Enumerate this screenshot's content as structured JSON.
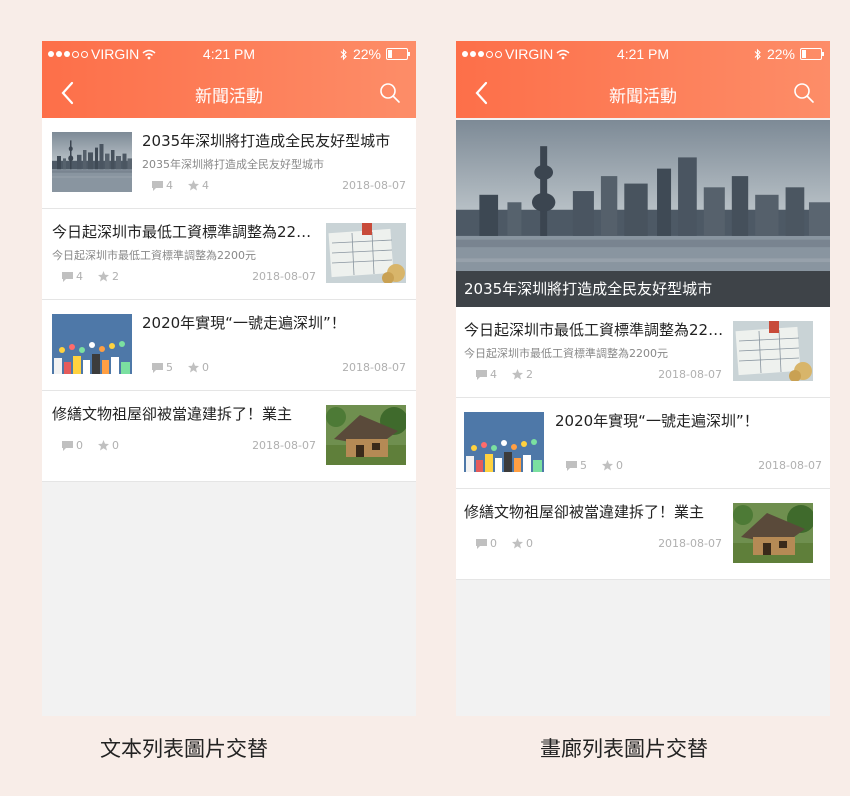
{
  "status_bar": {
    "carrier": "VIRGIN",
    "time": "4:21 PM",
    "battery": "22%"
  },
  "header": {
    "title": "新聞活動"
  },
  "articles": {
    "a1": {
      "title": "2035年深圳將打造成全民友好型城市",
      "subtitle": "2035年深圳將打造成全民友好型城市",
      "comments": "4",
      "stars": "4",
      "date": "2018-08-07"
    },
    "a2": {
      "title": "今日起深圳市最低工資標準調整為2200元",
      "subtitle": "今日起深圳市最低工資標準調整為2200元",
      "comments": "4",
      "stars": "2",
      "date": "2018-08-07"
    },
    "a3": {
      "title": "2020年實現“一號走遍深圳”！",
      "comments": "5",
      "stars": "0",
      "date": "2018-08-07"
    },
    "a4": {
      "title": "修繕文物祖屋卻被當違建拆了！業主",
      "comments": "0",
      "stars": "0",
      "date": "2018-08-07"
    }
  },
  "captions": {
    "left": "文本列表圖片交替",
    "right": "畫廊列表圖片交替"
  },
  "colors": {
    "header_start": "#fd6f49",
    "header_end": "#fd8d68",
    "background": "#f8ede8"
  }
}
